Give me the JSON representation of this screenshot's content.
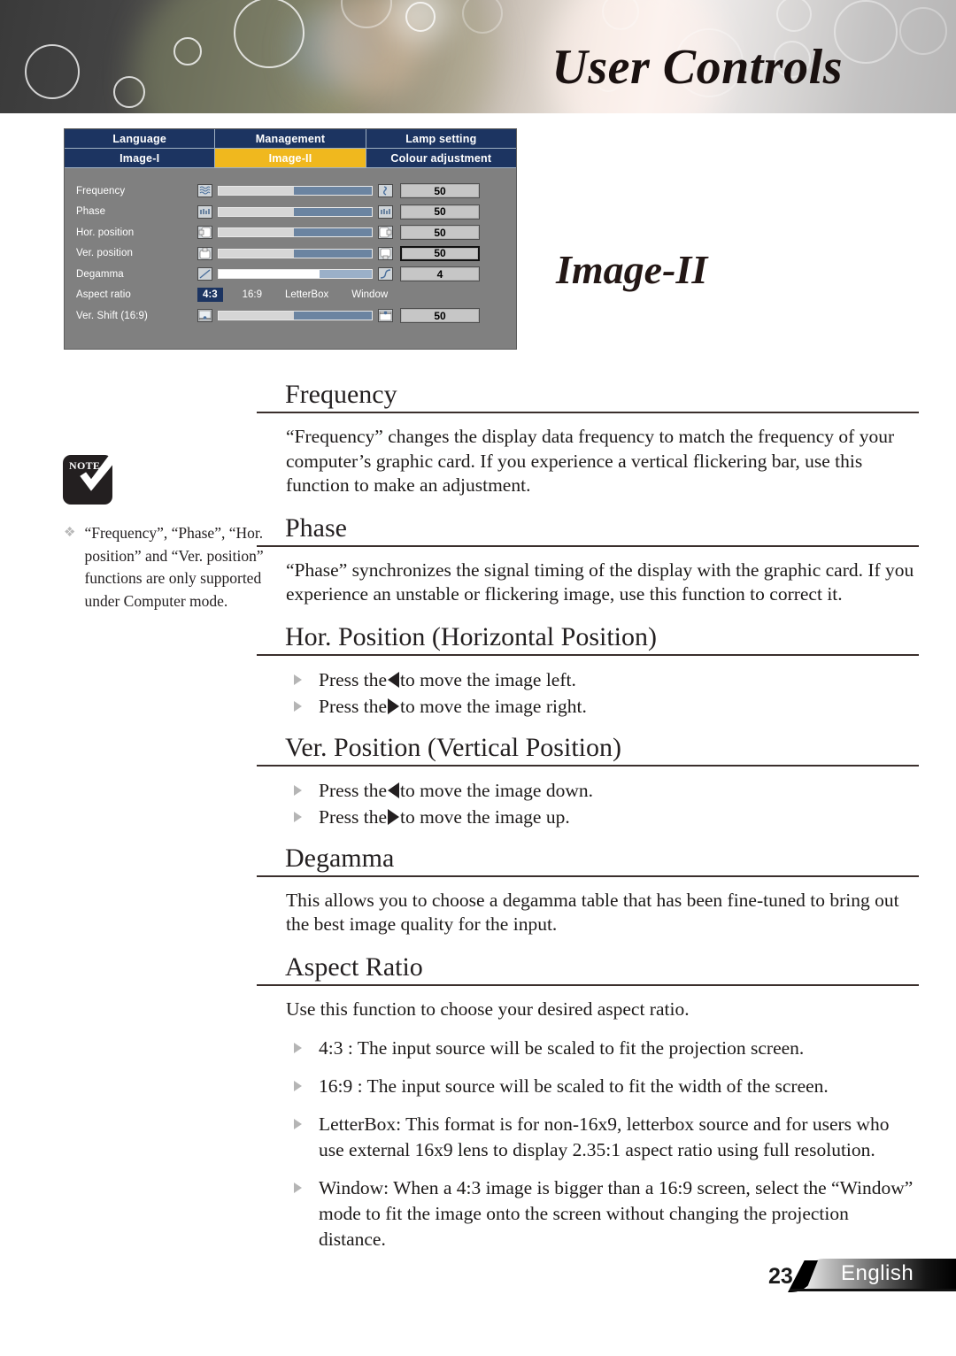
{
  "banner": {
    "title": "User Controls"
  },
  "page_title": "Image-II",
  "osd": {
    "tabs_row1": [
      "Language",
      "Management",
      "Lamp setting"
    ],
    "tabs_row2": [
      "Image-I",
      "Image-II",
      "Colour adjustment"
    ],
    "active_tab": "Image-II",
    "accent_active": "#f0b81e",
    "accent_tab": "#1c3461",
    "rows": [
      {
        "label": "Frequency",
        "value": "50",
        "fill_pct": 51,
        "icon": "frequency-icon"
      },
      {
        "label": "Phase",
        "value": "50",
        "fill_pct": 51,
        "icon": "phase-icon"
      },
      {
        "label": "Hor. position",
        "value": "50",
        "fill_pct": 51,
        "icon": "hor-position-icon"
      },
      {
        "label": "Ver. position",
        "value": "50",
        "fill_pct": 51,
        "icon": "ver-position-icon"
      },
      {
        "label": "Degamma",
        "value": "4",
        "fill_pct": 34,
        "icon": "degamma-icon"
      }
    ],
    "aspect_row": {
      "label": "Aspect ratio",
      "options": [
        "4:3",
        "16:9",
        "LetterBox",
        "Window"
      ],
      "selected": "4:3"
    },
    "shift_row": {
      "label": "Ver. Shift (16:9)",
      "value": "50",
      "fill_pct": 51
    }
  },
  "note": {
    "badge_label": "NOTE",
    "bullet": "❖",
    "text": "“Frequency”, “Phase”, “Hor. position” and “Ver. position” functions are only supported under Computer mode."
  },
  "sections": {
    "frequency": {
      "heading": "Frequency",
      "body": "“Frequency” changes the display data frequency to match the frequency of your computer’s graphic card. If you experience a vertical flickering bar, use this function to make an adjustment."
    },
    "phase": {
      "heading": "Phase",
      "body": "“Phase” synchronizes the signal timing of the display with the graphic card. If you experience an unstable or flickering image, use this function to correct it."
    },
    "hor_position": {
      "heading": "Hor. Position (Horizontal Position)",
      "items": [
        {
          "pre": "Press the",
          "arrow": "left",
          "post": "to move the image left."
        },
        {
          "pre": "Press the",
          "arrow": "right",
          "post": "to move the image right."
        }
      ]
    },
    "ver_position": {
      "heading": "Ver. Position (Vertical Position)",
      "items": [
        {
          "pre": "Press the",
          "arrow": "left",
          "post": "to move the image down."
        },
        {
          "pre": "Press the",
          "arrow": "right",
          "post": "to move the image up."
        }
      ]
    },
    "degamma": {
      "heading": "Degamma",
      "body": "This allows you to choose a degamma table that has been fine-tuned to bring out the best image quality for the input."
    },
    "aspect_ratio": {
      "heading": "Aspect Ratio",
      "body": "Use this function to choose your desired aspect ratio.",
      "items": [
        "4:3 : The input source will be scaled to fit the projection screen.",
        "16:9 : The input source will be scaled to fit the width of the screen.",
        "LetterBox: This format is for non-16x9, letterbox source and for users who use external 16x9 lens to display 2.35:1 aspect ratio using full resolution.",
        "Window: When a 4:3 image is bigger than a 16:9 screen, select the “Window” mode to fit the image onto the screen without changing the projection distance."
      ]
    }
  },
  "footer": {
    "page_number": "23",
    "language": "English"
  }
}
